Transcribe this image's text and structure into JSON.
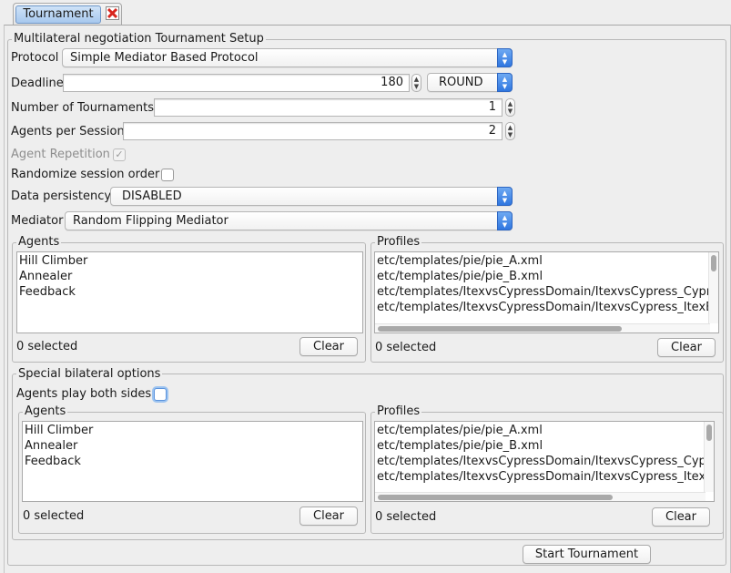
{
  "tab": {
    "label": "Tournament"
  },
  "setup": {
    "title": "Multilateral negotiation Tournament Setup",
    "protocol_label": "Protocol",
    "protocol_value": "Simple Mediator Based Protocol",
    "deadline_label": "Deadline",
    "deadline_value": "180",
    "deadline_unit": "ROUND",
    "tournaments_label": "Number of Tournaments",
    "tournaments_value": "1",
    "agents_per_session_label": "Agents per Session",
    "agents_per_session_value": "2",
    "agent_repetition_label": "Agent Repetition",
    "agent_repetition_checked": true,
    "randomize_label": "Randomize session order",
    "randomize_checked": false,
    "persistency_label": "Data persistency",
    "persistency_value": "DISABLED",
    "mediator_label": "Mediator",
    "mediator_value": "Random Flipping Mediator"
  },
  "agents_panel": {
    "title": "Agents",
    "items": [
      "Hill Climber",
      "Annealer",
      "Feedback"
    ],
    "selected_text": "0 selected",
    "clear_label": "Clear"
  },
  "profiles_panel": {
    "title": "Profiles",
    "items": [
      "etc/templates/pie/pie_A.xml",
      "etc/templates/pie/pie_B.xml",
      "etc/templates/ItexvsCypressDomain/ItexvsCypress_CypressAR",
      "etc/templates/ItexvsCypressDomain/ItexvsCypress_ItexBReser"
    ],
    "selected_text": "0 selected",
    "clear_label": "Clear"
  },
  "bilateral": {
    "title": "Special bilateral options",
    "both_sides_label": "Agents play both sides",
    "both_sides_checked": false,
    "agents": {
      "title": "Agents",
      "items": [
        "Hill Climber",
        "Annealer",
        "Feedback"
      ],
      "selected_text": "0 selected",
      "clear_label": "Clear"
    },
    "profiles": {
      "title": "Profiles",
      "items": [
        "etc/templates/pie/pie_A.xml",
        "etc/templates/pie/pie_B.xml",
        "etc/templates/ItexvsCypressDomain/ItexvsCypress_CypressA",
        "etc/templates/ItexvsCypressDomain/ItexvsCypress_ItexBRese"
      ],
      "selected_text": "0 selected",
      "clear_label": "Clear"
    }
  },
  "start_button": "Start Tournament",
  "colors": {
    "tab_selected": "#a7c8ee",
    "combo_arrow": "#2f76e0",
    "focus_ring": "#9cc3f0"
  }
}
